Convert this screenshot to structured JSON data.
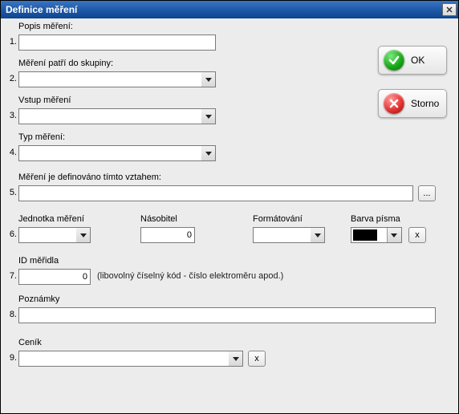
{
  "window": {
    "title": "Definice měření"
  },
  "buttons": {
    "ok": "OK",
    "cancel": "Storno",
    "ellipsis": "...",
    "x": "x"
  },
  "fields": {
    "n1": "1.",
    "label1": "Popis měření:",
    "val1": "",
    "n2": "2.",
    "label2": "Měření patří do skupiny:",
    "val2": "",
    "n3": "3.",
    "label3": "Vstup měření",
    "val3": "",
    "n4": "4.",
    "label4": "Typ měření:",
    "val4": "",
    "n5": "5.",
    "label5": "Měření je definováno tímto vztahem:",
    "val5": "",
    "n6": "6.",
    "label6a": "Jednotka měření",
    "val6a": "",
    "label6b": "Násobitel",
    "val6b": "0",
    "label6c": "Formátování",
    "val6c": "",
    "label6d": "Barva písma",
    "color6d": "#000000",
    "n7": "7.",
    "label7": "ID měřidla",
    "val7": "0",
    "hint7": "(libovolný číselný kód - číslo elektroměru apod.)",
    "n8": "8.",
    "label8": "Poznámky",
    "val8": "",
    "n9": "9.",
    "label9": "Ceník",
    "val9": ""
  }
}
